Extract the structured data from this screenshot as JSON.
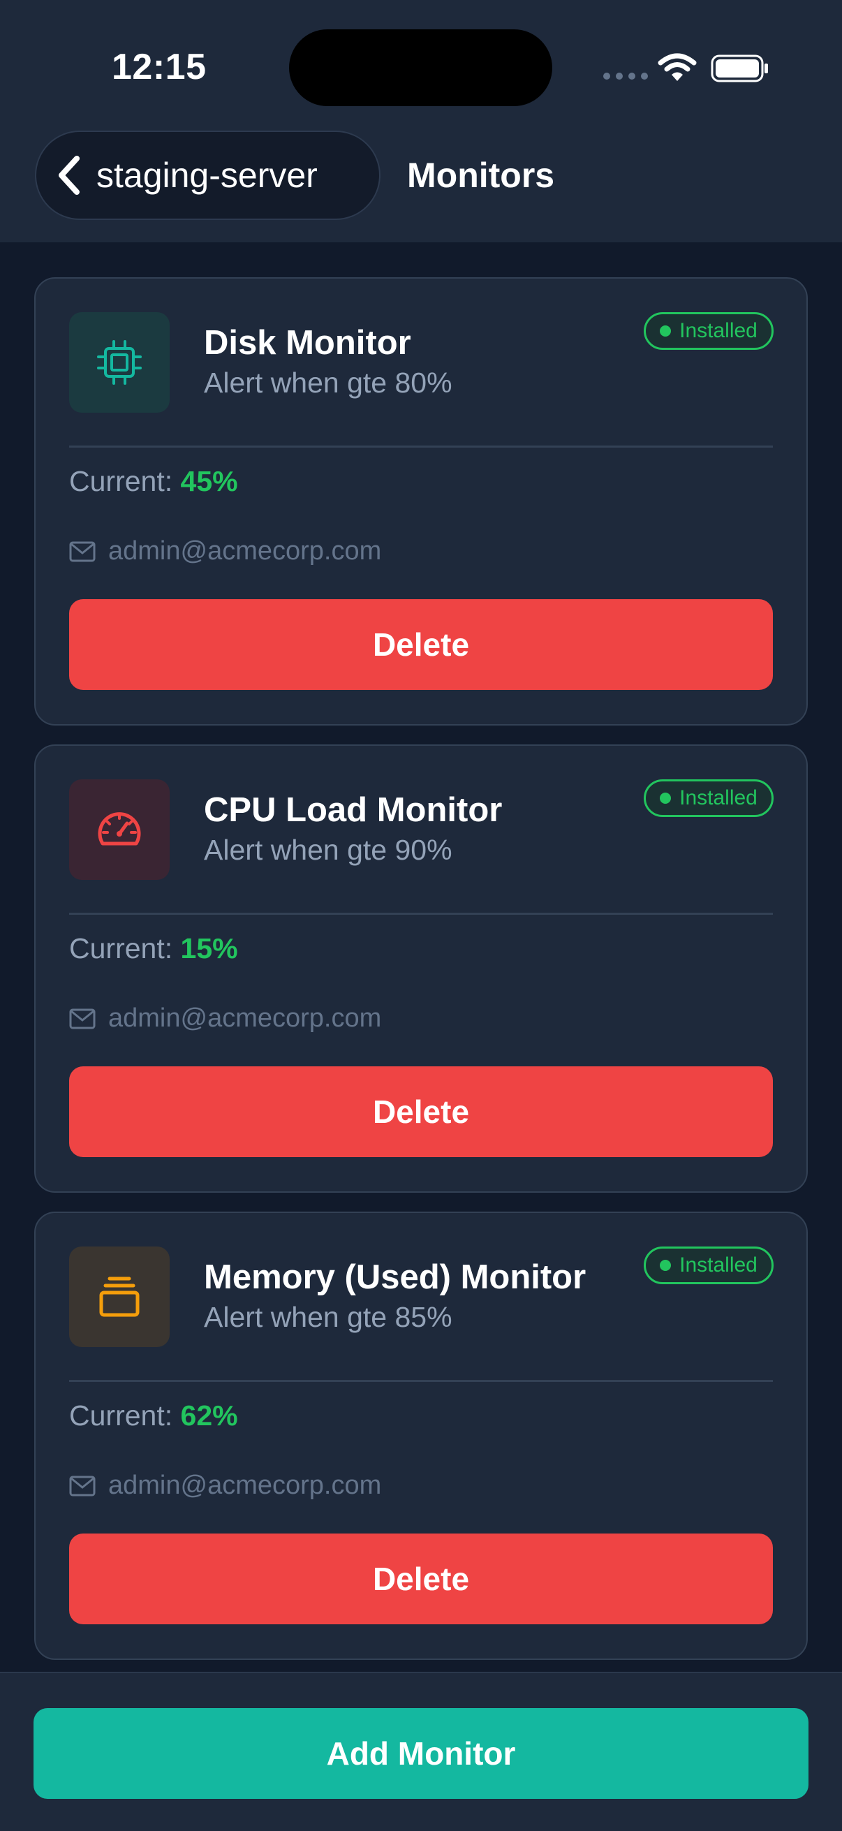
{
  "status_bar": {
    "time": "12:15"
  },
  "nav": {
    "back_label": "staging-server",
    "title": "Monitors"
  },
  "monitors": [
    {
      "title": "Disk Monitor",
      "subtitle": "Alert when gte 80%",
      "badge": "Installed",
      "current_label": "Current:",
      "current_value": "45%",
      "email": "admin@acmecorp.com",
      "delete_label": "Delete",
      "icon": "chip-icon",
      "icon_color": "#14b8a0"
    },
    {
      "title": "CPU Load Monitor",
      "subtitle": "Alert when gte 90%",
      "badge": "Installed",
      "current_label": "Current:",
      "current_value": "15%",
      "email": "admin@acmecorp.com",
      "delete_label": "Delete",
      "icon": "gauge-icon",
      "icon_color": "#ef4444"
    },
    {
      "title": "Memory (Used) Monitor",
      "subtitle": "Alert when gte 85%",
      "badge": "Installed",
      "current_label": "Current:",
      "current_value": "62%",
      "email": "admin@acmecorp.com",
      "delete_label": "Delete",
      "icon": "stack-icon",
      "icon_color": "#f59e0b"
    }
  ],
  "footer": {
    "add_label": "Add Monitor"
  },
  "colors": {
    "success": "#22c55e",
    "danger": "#ef4444",
    "accent": "#14b8a0",
    "warning": "#f59e0b"
  }
}
